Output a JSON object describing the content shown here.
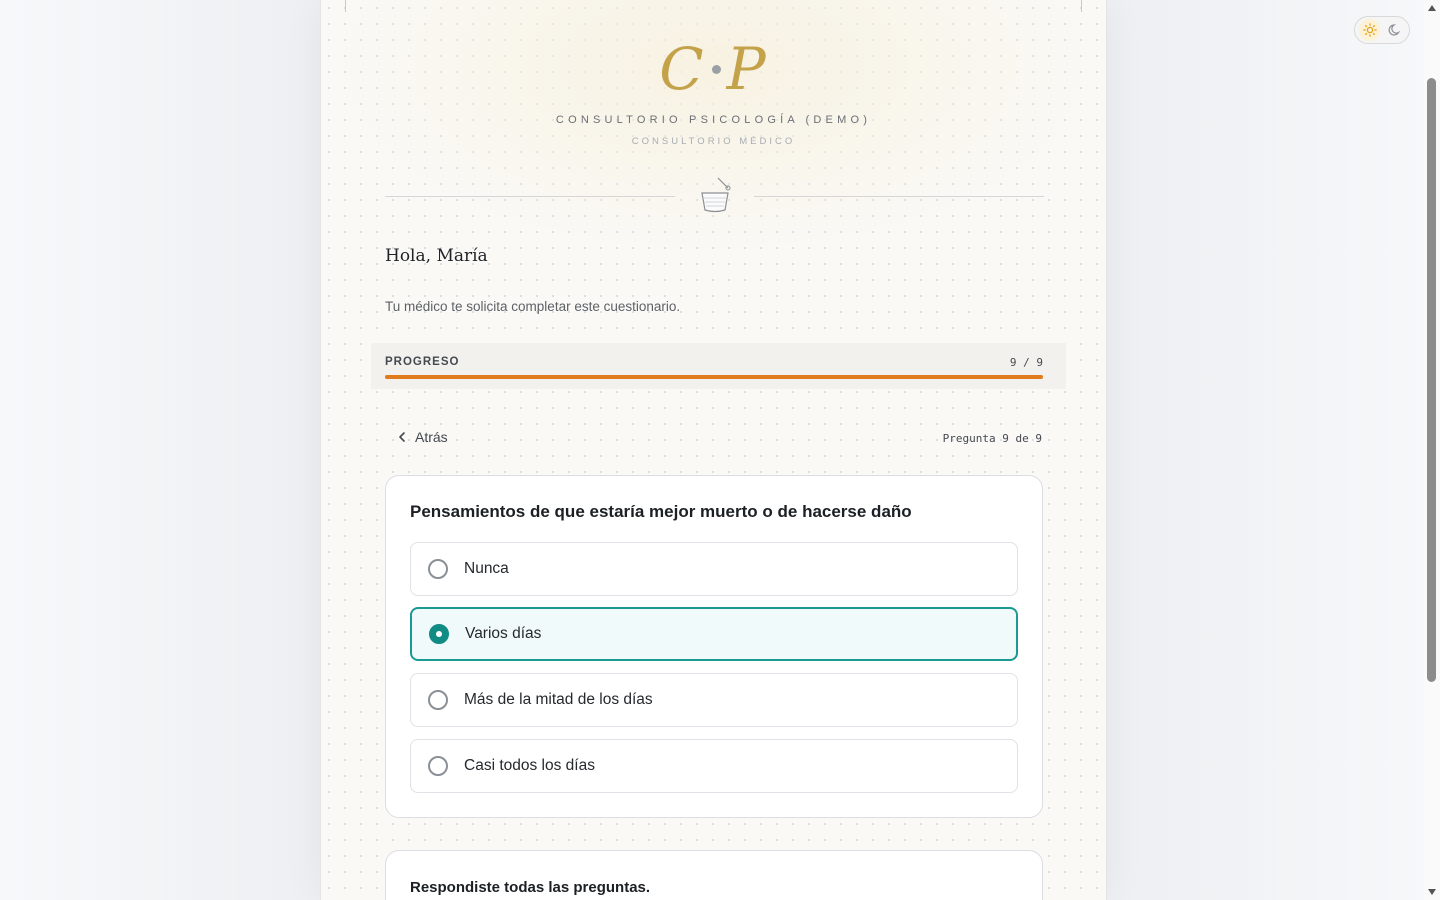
{
  "header": {
    "logo_left": "C",
    "logo_right": "P",
    "clinic_name": "CONSULTORIO PSICOLOGÍA (DEMO)",
    "clinic_sub": "CONSULTORIO MÉDICO",
    "divider_icon": "mortar-pestle-icon"
  },
  "greeting": "Hola, María",
  "subtitle": "Tu médico te solicita completar este cuestionario.",
  "progress": {
    "label": "PROGRESO",
    "count_text": "9 / 9",
    "fraction": 1.0,
    "color": "#e07a1c"
  },
  "nav": {
    "back_label": "Atrás",
    "question_count": "Pregunta 9 de 9"
  },
  "question": {
    "title": "Pensamientos de que estaría mejor muerto o de hacerse daño",
    "options": [
      {
        "label": "Nunca",
        "selected": false
      },
      {
        "label": "Varios días",
        "selected": true
      },
      {
        "label": "Más de la mitad de los días",
        "selected": false
      },
      {
        "label": "Casi todos los días",
        "selected": false
      }
    ],
    "accent_color": "#1a9a92"
  },
  "summary": {
    "title": "Respondiste todas las preguntas."
  },
  "theme_toggle": {
    "light_icon": "sun-icon",
    "dark_icon": "moon-icon",
    "active": "light"
  }
}
